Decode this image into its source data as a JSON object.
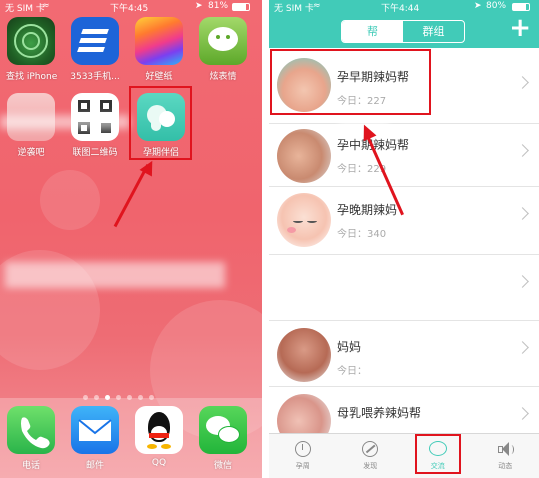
{
  "left_screen": {
    "status": {
      "carrier": "无 SIM 卡",
      "time": "下午4:45",
      "battery": "81%"
    },
    "apps": [
      {
        "label": "查找 iPhone",
        "icon": "find-iphone-icon"
      },
      {
        "label": "3533手机...",
        "icon": "3533-app-icon"
      },
      {
        "label": "好壁纸",
        "icon": "wallpaper-app-icon"
      },
      {
        "label": "炫表情",
        "icon": "emoji-app-icon"
      },
      {
        "label": "逆袭吧",
        "icon": "blurred-app-icon"
      },
      {
        "label": "联图二维码",
        "icon": "qrcode-app-icon"
      },
      {
        "label": "孕期伴侣",
        "icon": "pregnancy-companion-app-icon"
      }
    ],
    "dock": [
      {
        "label": "电话",
        "icon": "phone-icon"
      },
      {
        "label": "邮件",
        "icon": "mail-icon"
      },
      {
        "label": "QQ",
        "icon": "qq-icon"
      },
      {
        "label": "微信",
        "icon": "wechat-icon"
      }
    ],
    "page_dots": {
      "count": 7,
      "active_index": 2
    }
  },
  "right_screen": {
    "status": {
      "carrier": "无 SIM 卡",
      "time": "下午4:44",
      "battery": "80%"
    },
    "segments": {
      "first": "帮",
      "second": "群组",
      "selected_index": 0
    },
    "plus_label": "+",
    "groups": [
      {
        "name": "孕早期辣妈帮",
        "count": "今日：227"
      },
      {
        "name": "孕中期辣妈帮",
        "count": "今日：229"
      },
      {
        "name": "孕晚期辣妈",
        "count": "今日：340"
      },
      {
        "name": "",
        "count": ""
      },
      {
        "name": "妈妈",
        "count": "今日："
      },
      {
        "name": "母乳喂养辣妈帮",
        "count": ""
      }
    ],
    "tabs": [
      {
        "label": "孕周",
        "icon": "clock-icon"
      },
      {
        "label": "发现",
        "icon": "compass-icon"
      },
      {
        "label": "交流",
        "icon": "chat-bubble-icon",
        "active": true
      },
      {
        "label": "动态",
        "icon": "speaker-icon"
      }
    ]
  },
  "colors": {
    "accent": "#41cbb8",
    "highlight": "#e0141e",
    "wallpaper": "#f0646d"
  }
}
